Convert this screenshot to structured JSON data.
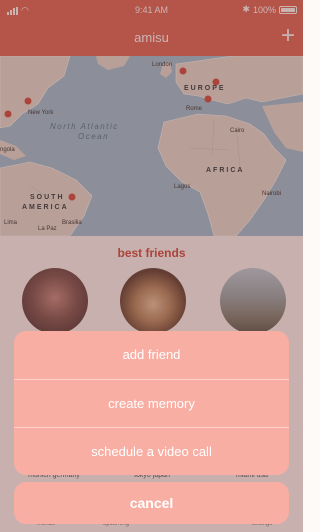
{
  "status_bar": {
    "time": "9:41 AM",
    "battery": "100%"
  },
  "nav": {
    "title": "amisu"
  },
  "map": {
    "labels": {
      "europe": "EUROPE",
      "africa": "AFRICA",
      "south_america_line1": "SOUTH",
      "south_america_line2": "AMERICA",
      "ocean_line1": "North Atlantic",
      "ocean_line2": "Ocean",
      "london": "London",
      "new_york": "New York",
      "rome": "Rome",
      "cairo": "Cairo",
      "lagos": "Lagos",
      "nairobi": "Nairobi",
      "lima": "Lima",
      "la_paz": "La Paz",
      "brasilia": "Brasilia",
      "angola": "ngola"
    }
  },
  "friends": {
    "title": "best friends",
    "captions": [
      "munich germany",
      "tokyo japan",
      "miami usa"
    ]
  },
  "tabs": [
    "friends",
    "upcoming",
    "",
    "settings"
  ],
  "action_sheet": {
    "items": [
      "add friend",
      "create memory",
      "schedule a video call"
    ],
    "cancel": "cancel"
  },
  "colors": {
    "accent": "#e1685a",
    "title_red": "#d24c41",
    "sheet": "#f9aea3"
  }
}
